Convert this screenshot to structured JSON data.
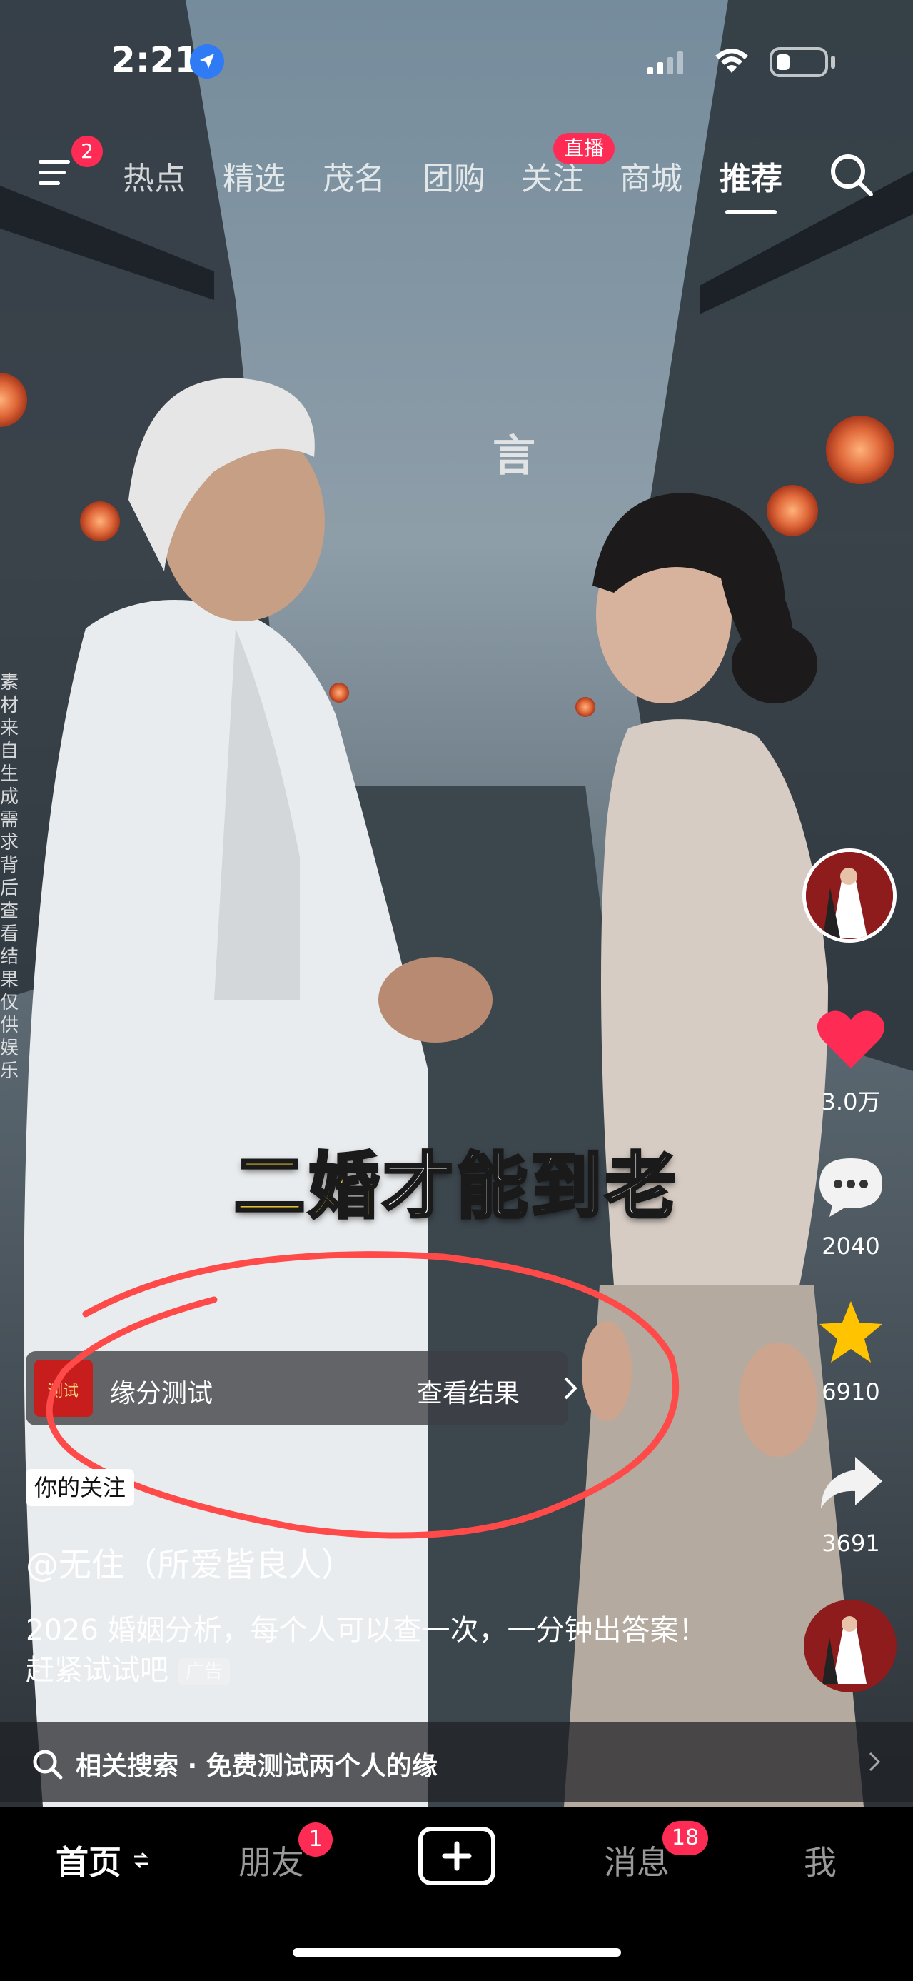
{
  "status_bar": {
    "time": "2:21"
  },
  "top_nav": {
    "menu_badge": "2",
    "tabs": [
      {
        "label": "热点"
      },
      {
        "label": "精选"
      },
      {
        "label": "茂名"
      },
      {
        "label": "团购"
      },
      {
        "label": "关注"
      },
      {
        "label": "商城"
      },
      {
        "label": "推荐"
      }
    ],
    "live_badge": "直播",
    "active_tab": "推荐"
  },
  "video": {
    "caption_highlight_prefix": "二",
    "caption_highlight": "婚",
    "caption_rest": "才能到老",
    "watermark": "言",
    "side_text": "素材来自生成需求背后查看结果仅供娱乐"
  },
  "right_rail": {
    "like_count": "3.0万",
    "comment_count": "2040",
    "favorite_count": "6910",
    "share_count": "3691"
  },
  "ad_card": {
    "thumb_text": "测试",
    "title": "缘分测试",
    "action": "查看结果"
  },
  "post": {
    "follow_badge": "你的关注",
    "author": "@无住（所爱皆良人）",
    "description": "2026 婚姻分析，每个人可以查一次，一分钟出答案！赶紧试试吧",
    "ad_tag": "广告"
  },
  "related_search": {
    "text": "相关搜索 · 免费测试两个人的缘"
  },
  "bottom_nav": {
    "home": "首页",
    "friends": "朋友",
    "friends_badge": "1",
    "messages": "消息",
    "messages_badge": "18",
    "me": "我"
  },
  "colors": {
    "accent": "#fe2c55",
    "caption_highlight": "#ffd83a",
    "annotation": "#ff4a4a"
  }
}
